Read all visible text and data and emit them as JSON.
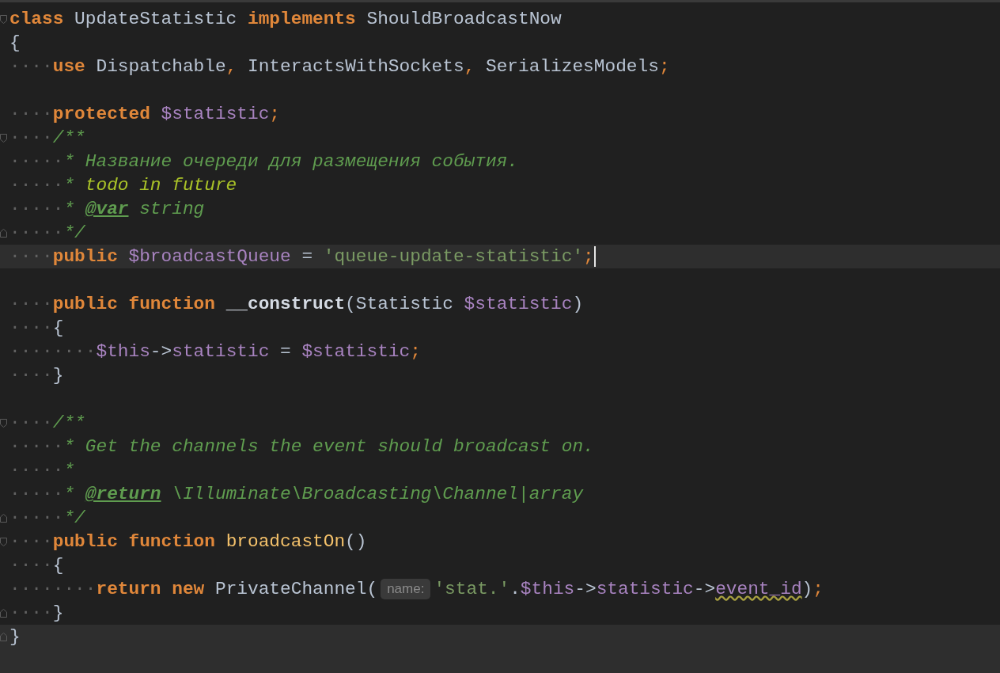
{
  "editor": {
    "lines": [
      {
        "highlighted": false,
        "caret": false,
        "fold_start": true,
        "fold_end": false,
        "tokens": [
          {
            "kind": "kw",
            "text": "class"
          },
          {
            "kind": "plain",
            "text": " UpdateStatistic "
          },
          {
            "kind": "kw",
            "text": "implements"
          },
          {
            "kind": "plain",
            "text": " ShouldBroadcastNow"
          }
        ]
      },
      {
        "highlighted": false,
        "caret": false,
        "fold_start": false,
        "fold_end": false,
        "tokens": [
          {
            "kind": "plain",
            "text": "{"
          }
        ]
      },
      {
        "highlighted": false,
        "caret": false,
        "fold_start": false,
        "fold_end": false,
        "tokens": [
          {
            "kind": "ws",
            "text": "····"
          },
          {
            "kind": "kw",
            "text": "use"
          },
          {
            "kind": "plain",
            "text": " Dispatchable"
          },
          {
            "kind": "punct",
            "text": ","
          },
          {
            "kind": "plain",
            "text": " InteractsWithSockets"
          },
          {
            "kind": "punct",
            "text": ","
          },
          {
            "kind": "plain",
            "text": " SerializesModels"
          },
          {
            "kind": "punct",
            "text": ";"
          }
        ]
      },
      {
        "highlighted": false,
        "caret": false,
        "fold_start": false,
        "fold_end": false
      },
      {
        "highlighted": false,
        "caret": false,
        "fold_start": false,
        "fold_end": false,
        "tokens": [
          {
            "kind": "ws",
            "text": "····"
          },
          {
            "kind": "kw",
            "text": "protected "
          },
          {
            "kind": "var",
            "text": "$statistic"
          },
          {
            "kind": "punct",
            "text": ";"
          }
        ]
      },
      {
        "highlighted": false,
        "caret": false,
        "fold_start": true,
        "fold_end": false,
        "tokens": [
          {
            "kind": "ws",
            "text": "····"
          },
          {
            "kind": "cmt",
            "text": "/**"
          }
        ]
      },
      {
        "highlighted": false,
        "caret": false,
        "fold_start": false,
        "fold_end": false,
        "tokens": [
          {
            "kind": "ws",
            "text": "·····"
          },
          {
            "kind": "cmt",
            "text": "* Название очереди для размещения события."
          }
        ]
      },
      {
        "highlighted": false,
        "caret": false,
        "fold_start": false,
        "fold_end": false,
        "tokens": [
          {
            "kind": "ws",
            "text": "·····"
          },
          {
            "kind": "cmt",
            "text": "*"
          },
          {
            "kind": "todo",
            "text": " todo in future"
          }
        ]
      },
      {
        "highlighted": false,
        "caret": false,
        "fold_start": false,
        "fold_end": false,
        "tokens": [
          {
            "kind": "ws",
            "text": "·····"
          },
          {
            "kind": "cmt",
            "text": "*"
          },
          {
            "kind": "tag",
            "text": "@var"
          },
          {
            "kind": "cmt",
            "text": " string"
          }
        ]
      },
      {
        "highlighted": false,
        "caret": false,
        "fold_start": false,
        "fold_end": true,
        "tokens": [
          {
            "kind": "ws",
            "text": "·····"
          },
          {
            "kind": "cmt",
            "text": "*/"
          }
        ]
      },
      {
        "highlighted": true,
        "caret": true,
        "fold_start": false,
        "fold_end": false,
        "tokens": [
          {
            "kind": "ws",
            "text": "····"
          },
          {
            "kind": "kw",
            "text": "public "
          },
          {
            "kind": "var",
            "text": "$broadcastQueue"
          },
          {
            "kind": "plain",
            "text": " = "
          },
          {
            "kind": "str",
            "text": "'queue-update-statistic'"
          },
          {
            "kind": "punct",
            "text": ";"
          }
        ]
      },
      {
        "highlighted": false,
        "caret": false,
        "fold_start": false,
        "fold_end": false
      },
      {
        "highlighted": false,
        "caret": false,
        "fold_start": false,
        "fold_end": false,
        "tokens": [
          {
            "kind": "ws",
            "text": "····"
          },
          {
            "kind": "kw",
            "text": "public function "
          },
          {
            "kind": "magic",
            "text": "__construct"
          },
          {
            "kind": "plain",
            "text": "(Statistic "
          },
          {
            "kind": "var",
            "text": "$statistic"
          },
          {
            "kind": "plain",
            "text": ")"
          }
        ]
      },
      {
        "highlighted": false,
        "caret": false,
        "fold_start": false,
        "fold_end": false,
        "tokens": [
          {
            "kind": "ws",
            "text": "····"
          },
          {
            "kind": "plain",
            "text": "{"
          }
        ]
      },
      {
        "highlighted": false,
        "caret": false,
        "fold_start": false,
        "fold_end": false,
        "tokens": [
          {
            "kind": "ws",
            "text": "········"
          },
          {
            "kind": "var",
            "text": "$this"
          },
          {
            "kind": "plain",
            "text": "->"
          },
          {
            "kind": "var",
            "text": "statistic"
          },
          {
            "kind": "plain",
            "text": " = "
          },
          {
            "kind": "var",
            "text": "$statistic"
          },
          {
            "kind": "punct",
            "text": ";"
          }
        ]
      },
      {
        "highlighted": false,
        "caret": false,
        "fold_start": false,
        "fold_end": false,
        "tokens": [
          {
            "kind": "ws",
            "text": "····"
          },
          {
            "kind": "plain",
            "text": "}"
          }
        ]
      },
      {
        "highlighted": false,
        "caret": false,
        "fold_start": false,
        "fold_end": false
      },
      {
        "highlighted": false,
        "caret": false,
        "fold_start": true,
        "fold_end": false,
        "tokens": [
          {
            "kind": "ws",
            "text": "····"
          },
          {
            "kind": "cmt",
            "text": "/**"
          }
        ]
      },
      {
        "highlighted": false,
        "caret": false,
        "fold_start": false,
        "fold_end": false,
        "tokens": [
          {
            "kind": "ws",
            "text": "·····"
          },
          {
            "kind": "cmt",
            "text": "* Get the channels the event should broadcast on."
          }
        ]
      },
      {
        "highlighted": false,
        "caret": false,
        "fold_start": false,
        "fold_end": false,
        "tokens": [
          {
            "kind": "ws",
            "text": "·····"
          },
          {
            "kind": "cmt",
            "text": "*"
          }
        ]
      },
      {
        "highlighted": false,
        "caret": false,
        "fold_start": false,
        "fold_end": false,
        "tokens": [
          {
            "kind": "ws",
            "text": "·····"
          },
          {
            "kind": "cmt",
            "text": "*"
          },
          {
            "kind": "tag",
            "text": "@return"
          },
          {
            "kind": "cmt",
            "text": " \\Illuminate\\Broadcasting\\Channel|array"
          }
        ]
      },
      {
        "highlighted": false,
        "caret": false,
        "fold_start": false,
        "fold_end": true,
        "tokens": [
          {
            "kind": "ws",
            "text": "·····"
          },
          {
            "kind": "cmt",
            "text": "*/"
          }
        ]
      },
      {
        "highlighted": false,
        "caret": false,
        "fold_start": true,
        "fold_end": false,
        "tokens": [
          {
            "kind": "ws",
            "text": "····"
          },
          {
            "kind": "kw",
            "text": "public function "
          },
          {
            "kind": "fn",
            "text": "broadcastOn"
          },
          {
            "kind": "plain",
            "text": "()"
          }
        ]
      },
      {
        "highlighted": false,
        "caret": false,
        "fold_start": false,
        "fold_end": false,
        "tokens": [
          {
            "kind": "ws",
            "text": "····"
          },
          {
            "kind": "plain",
            "text": "{"
          }
        ]
      },
      {
        "highlighted": false,
        "caret": false,
        "fold_start": false,
        "fold_end": false,
        "tokens": [
          {
            "kind": "ws",
            "text": "········"
          },
          {
            "kind": "kw",
            "text": "return new"
          },
          {
            "kind": "plain",
            "text": " PrivateChannel("
          },
          {
            "kind": "hint",
            "text": "name:"
          },
          {
            "kind": "str",
            "text": "'stat.'"
          },
          {
            "kind": "plain",
            "text": "."
          },
          {
            "kind": "var",
            "text": "$this"
          },
          {
            "kind": "plain",
            "text": "->"
          },
          {
            "kind": "var",
            "text": "statistic"
          },
          {
            "kind": "plain",
            "text": "->"
          },
          {
            "kind": "warn",
            "text": "event_id"
          },
          {
            "kind": "plain",
            "text": ")"
          },
          {
            "kind": "punct",
            "text": ";"
          }
        ]
      },
      {
        "highlighted": false,
        "caret": false,
        "fold_start": false,
        "fold_end": true,
        "tokens": [
          {
            "kind": "ws",
            "text": "····"
          },
          {
            "kind": "plain",
            "text": "}"
          }
        ]
      },
      {
        "highlighted": true,
        "caret": false,
        "fold_start": false,
        "fold_end": true,
        "tokens": [
          {
            "kind": "plain",
            "text": "}"
          }
        ]
      }
    ]
  }
}
